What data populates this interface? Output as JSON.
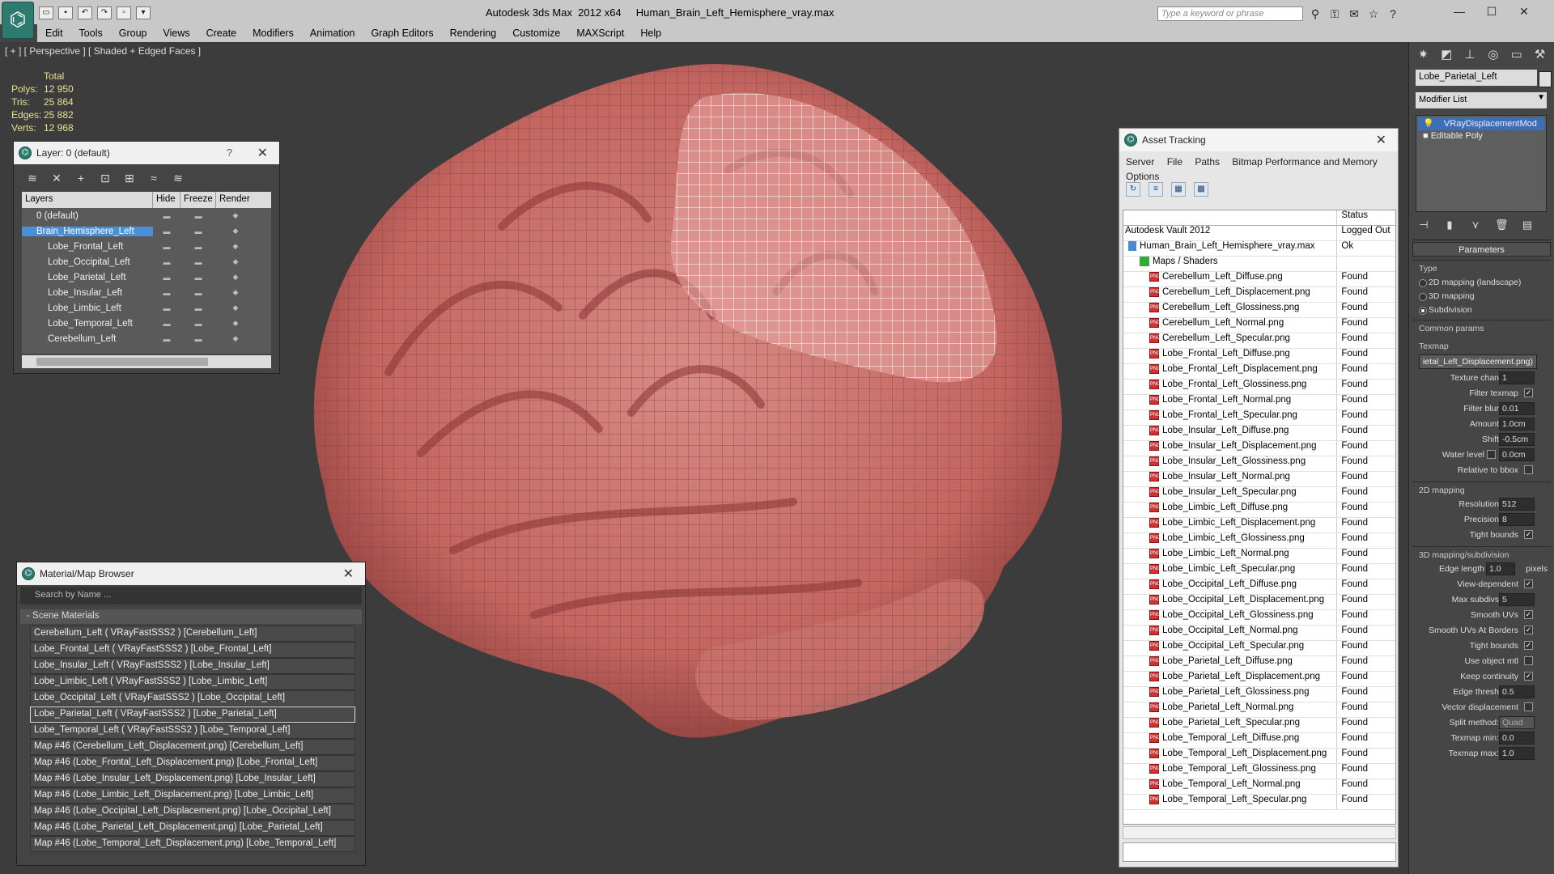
{
  "window": {
    "title": "Autodesk 3ds Max  2012 x64",
    "file": "Human_Brain_Left_Hemisphere_vray.max",
    "search_placeholder": "Type a keyword or phrase"
  },
  "menu": [
    "Edit",
    "Tools",
    "Group",
    "Views",
    "Create",
    "Modifiers",
    "Animation",
    "Graph Editors",
    "Rendering",
    "Customize",
    "MAXScript",
    "Help"
  ],
  "viewport": {
    "label": "[ + ] [ Perspective ] [ Shaded + Edged Faces ]",
    "stats": {
      "header": "Total",
      "polys_label": "Polys:",
      "polys": "12 950",
      "tris_label": "Tris:",
      "tris": "25 864",
      "edges_label": "Edges:",
      "edges": "25 882",
      "verts_label": "Verts:",
      "verts": "12 968"
    }
  },
  "layer_panel": {
    "title": "Layer: 0 (default)",
    "help": "?",
    "columns": [
      "Layers",
      "Hide",
      "Freeze",
      "Render"
    ],
    "rows": [
      "0 (default)",
      "Brain_Hemisphere_Left",
      "Lobe_Frontal_Left",
      "Lobe_Occipital_Left",
      "Lobe_Parietal_Left",
      "Lobe_Insular_Left",
      "Lobe_Limbic_Left",
      "Lobe_Temporal_Left",
      "Cerebellum_Left"
    ]
  },
  "material_browser": {
    "title": "Material/Map Browser",
    "search_placeholder": "Search by Name ...",
    "group": "- Scene Materials",
    "items": [
      "Cerebellum_Left  ( VRayFastSSS2 )  [Cerebellum_Left]",
      "Lobe_Frontal_Left  ( VRayFastSSS2 )  [Lobe_Frontal_Left]",
      "Lobe_Insular_Left  ( VRayFastSSS2 )  [Lobe_Insular_Left]",
      "Lobe_Limbic_Left  ( VRayFastSSS2 )  [Lobe_Limbic_Left]",
      "Lobe_Occipital_Left  ( VRayFastSSS2 )  [Lobe_Occipital_Left]",
      "Lobe_Parietal_Left  ( VRayFastSSS2 )  [Lobe_Parietal_Left]",
      "Lobe_Temporal_Left  ( VRayFastSSS2 )  [Lobe_Temporal_Left]",
      "Map #46 (Cerebellum_Left_Displacement.png)  [Cerebellum_Left]",
      "Map #46 (Lobe_Frontal_Left_Displacement.png)  [Lobe_Frontal_Left]",
      "Map #46 (Lobe_Insular_Left_Displacement.png)  [Lobe_Insular_Left]",
      "Map #46 (Lobe_Limbic_Left_Displacement.png)  [Lobe_Limbic_Left]",
      "Map #46 (Lobe_Occipital_Left_Displacement.png)  [Lobe_Occipital_Left]",
      "Map #46 (Lobe_Parietal_Left_Displacement.png)  [Lobe_Parietal_Left]",
      "Map #46 (Lobe_Temporal_Left_Displacement.png)  [Lobe_Temporal_Left]"
    ]
  },
  "asset_tracking": {
    "title": "Asset Tracking",
    "menu": [
      "Server",
      "File",
      "Paths",
      "Bitmap Performance and Memory",
      "Options"
    ],
    "status_header": "Status",
    "vault": {
      "name": "Autodesk Vault 2012",
      "status": "Logged Out"
    },
    "file": {
      "name": "Human_Brain_Left_Hemisphere_vray.max",
      "status": "Ok"
    },
    "maps_label": "Maps / Shaders",
    "assets": [
      {
        "name": "Cerebellum_Left_Diffuse.png",
        "status": "Found"
      },
      {
        "name": "Cerebellum_Left_Displacement.png",
        "status": "Found"
      },
      {
        "name": "Cerebellum_Left_Glossiness.png",
        "status": "Found"
      },
      {
        "name": "Cerebellum_Left_Normal.png",
        "status": "Found"
      },
      {
        "name": "Cerebellum_Left_Specular.png",
        "status": "Found"
      },
      {
        "name": "Lobe_Frontal_Left_Diffuse.png",
        "status": "Found"
      },
      {
        "name": "Lobe_Frontal_Left_Displacement.png",
        "status": "Found"
      },
      {
        "name": "Lobe_Frontal_Left_Glossiness.png",
        "status": "Found"
      },
      {
        "name": "Lobe_Frontal_Left_Normal.png",
        "status": "Found"
      },
      {
        "name": "Lobe_Frontal_Left_Specular.png",
        "status": "Found"
      },
      {
        "name": "Lobe_Insular_Left_Diffuse.png",
        "status": "Found"
      },
      {
        "name": "Lobe_Insular_Left_Displacement.png",
        "status": "Found"
      },
      {
        "name": "Lobe_Insular_Left_Glossiness.png",
        "status": "Found"
      },
      {
        "name": "Lobe_Insular_Left_Normal.png",
        "status": "Found"
      },
      {
        "name": "Lobe_Insular_Left_Specular.png",
        "status": "Found"
      },
      {
        "name": "Lobe_Limbic_Left_Diffuse.png",
        "status": "Found"
      },
      {
        "name": "Lobe_Limbic_Left_Displacement.png",
        "status": "Found"
      },
      {
        "name": "Lobe_Limbic_Left_Glossiness.png",
        "status": "Found"
      },
      {
        "name": "Lobe_Limbic_Left_Normal.png",
        "status": "Found"
      },
      {
        "name": "Lobe_Limbic_Left_Specular.png",
        "status": "Found"
      },
      {
        "name": "Lobe_Occipital_Left_Diffuse.png",
        "status": "Found"
      },
      {
        "name": "Lobe_Occipital_Left_Displacement.png",
        "status": "Found"
      },
      {
        "name": "Lobe_Occipital_Left_Glossiness.png",
        "status": "Found"
      },
      {
        "name": "Lobe_Occipital_Left_Normal.png",
        "status": "Found"
      },
      {
        "name": "Lobe_Occipital_Left_Specular.png",
        "status": "Found"
      },
      {
        "name": "Lobe_Parietal_Left_Diffuse.png",
        "status": "Found"
      },
      {
        "name": "Lobe_Parietal_Left_Displacement.png",
        "status": "Found"
      },
      {
        "name": "Lobe_Parietal_Left_Glossiness.png",
        "status": "Found"
      },
      {
        "name": "Lobe_Parietal_Left_Normal.png",
        "status": "Found"
      },
      {
        "name": "Lobe_Parietal_Left_Specular.png",
        "status": "Found"
      },
      {
        "name": "Lobe_Temporal_Left_Diffuse.png",
        "status": "Found"
      },
      {
        "name": "Lobe_Temporal_Left_Displacement.png",
        "status": "Found"
      },
      {
        "name": "Lobe_Temporal_Left_Glossiness.png",
        "status": "Found"
      },
      {
        "name": "Lobe_Temporal_Left_Normal.png",
        "status": "Found"
      },
      {
        "name": "Lobe_Temporal_Left_Specular.png",
        "status": "Found"
      }
    ]
  },
  "command_panel": {
    "object_name": "Lobe_Parietal_Left",
    "modifier_list": "Modifier List",
    "stack": [
      "VRayDisplacementMod",
      "Editable Poly"
    ],
    "parameters": "Parameters",
    "type_label": "Type",
    "type_options": [
      "2D mapping (landscape)",
      "3D mapping",
      "Subdivision"
    ],
    "common_params": "Common params",
    "texmap_label": "Texmap",
    "texmap": "ietal_Left_Displacement.png)",
    "texture_chan_label": "Texture chan",
    "texture_chan": "1",
    "filter_texmap": "Filter texmap",
    "filter_blur_label": "Filter blur",
    "filter_blur": "0.01",
    "amount_label": "Amount",
    "amount": "1.0cm",
    "shift_label": "Shift",
    "shift": "-0.5cm",
    "water_label": "Water level",
    "water": "0.0cm",
    "relative_bbox": "Relative to bbox",
    "mapping2d": "2D mapping",
    "resolution_label": "Resolution",
    "resolution": "512",
    "precision_label": "Precision",
    "precision": "8",
    "tight_bounds": "Tight bounds",
    "mapping3d": "3D mapping/subdivision",
    "edge_length_label": "Edge length",
    "edge_length": "1.0",
    "pixels": "pixels",
    "view_dependent": "View-dependent",
    "max_subdivs_label": "Max subdivs",
    "max_subdivs": "5",
    "smooth_uvs": "Smooth UVs",
    "smooth_uvs_borders": "Smooth UVs At Borders",
    "tight_bounds2": "Tight bounds",
    "use_object_mtl": "Use object mtl",
    "keep_continuity": "Keep continuity",
    "edge_thresh_label": "Edge thresh",
    "edge_thresh": "0.5",
    "vector_disp": "Vector displacement",
    "split_method_label": "Split method:",
    "split_method": "Quad",
    "texmap_min_label": "Texmap min:",
    "texmap_min": "0.0",
    "texmap_max_label": "Texmap max:",
    "texmap_max": "1.0"
  }
}
